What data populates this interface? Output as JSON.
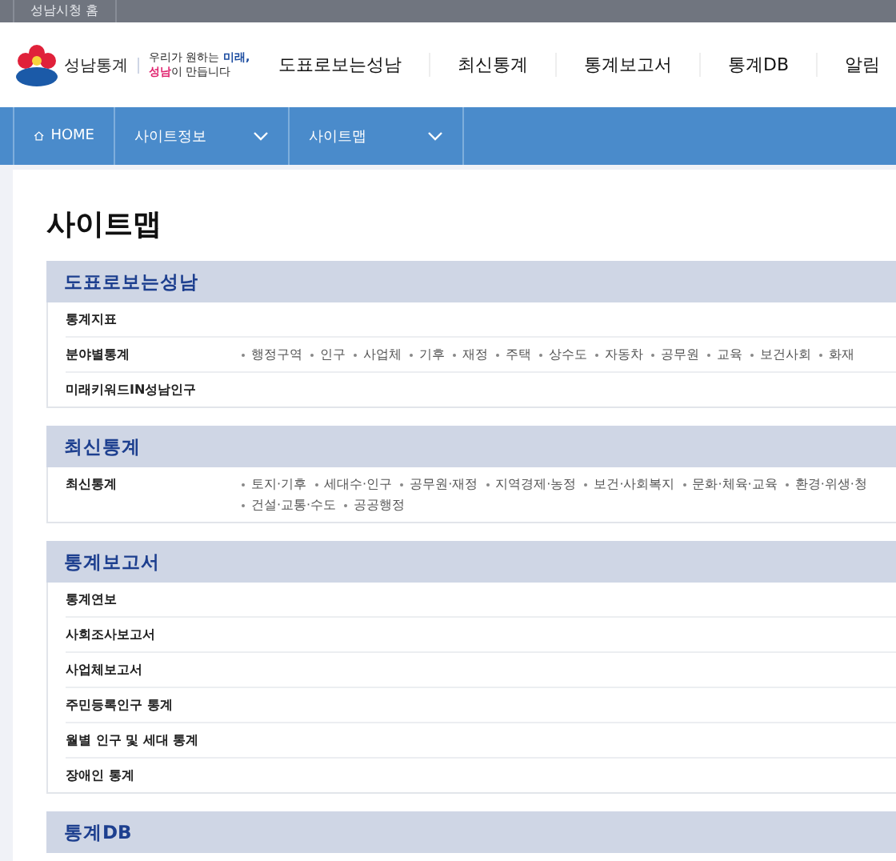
{
  "top_bar": {
    "home_link": "성남시청 홈"
  },
  "header": {
    "brand": "성남통계",
    "slogan_lines": [
      [
        {
          "text": "우리가 원하는 ",
          "kind": "plain"
        },
        {
          "text": "미래,",
          "kind": "accent"
        }
      ],
      [
        {
          "text": "성남",
          "kind": "highlight"
        },
        {
          "text": "이 만듭니다",
          "kind": "plain"
        }
      ]
    ],
    "menu": [
      "도표로보는성남",
      "최신통계",
      "통계보고서",
      "통계DB",
      "알림"
    ]
  },
  "breadcrumb": [
    {
      "label": "HOME",
      "kind": "home"
    },
    {
      "label": "사이트정보",
      "kind": "dropdown"
    },
    {
      "label": "사이트맵",
      "kind": "dropdown"
    }
  ],
  "page_title": "사이트맵",
  "sections": [
    {
      "title": "도표로보는성남",
      "rows": [
        {
          "label": "통계지표",
          "link_lines": []
        },
        {
          "label": "분야별통계",
          "link_lines": [
            [
              "행정구역",
              "인구",
              "사업체",
              "기후",
              "재정",
              "주택",
              "상수도",
              "자동차",
              "공무원",
              "교육",
              "보건사회",
              "화재"
            ]
          ]
        },
        {
          "label": "미래키워드IN성남인구",
          "link_lines": []
        }
      ]
    },
    {
      "title": "최신통계",
      "rows": [
        {
          "label": "최신통계",
          "link_lines": [
            [
              "토지·기후",
              "세대수·인구",
              "공무원·재정",
              "지역경제·농정",
              "보건·사회복지",
              "문화·체육·교육",
              "환경·위생·청"
            ],
            [
              "건설·교통·수도",
              "공공행정"
            ]
          ]
        }
      ]
    },
    {
      "title": "통계보고서",
      "rows": [
        {
          "label": "통계연보",
          "link_lines": []
        },
        {
          "label": "사회조사보고서",
          "link_lines": []
        },
        {
          "label": "사업체보고서",
          "link_lines": []
        },
        {
          "label": "주민등록인구 통계",
          "link_lines": []
        },
        {
          "label": "월별 인구 및 세대 통계",
          "link_lines": []
        },
        {
          "label": "장애인 통계",
          "link_lines": []
        }
      ]
    },
    {
      "title": "통계DB"
    }
  ]
}
